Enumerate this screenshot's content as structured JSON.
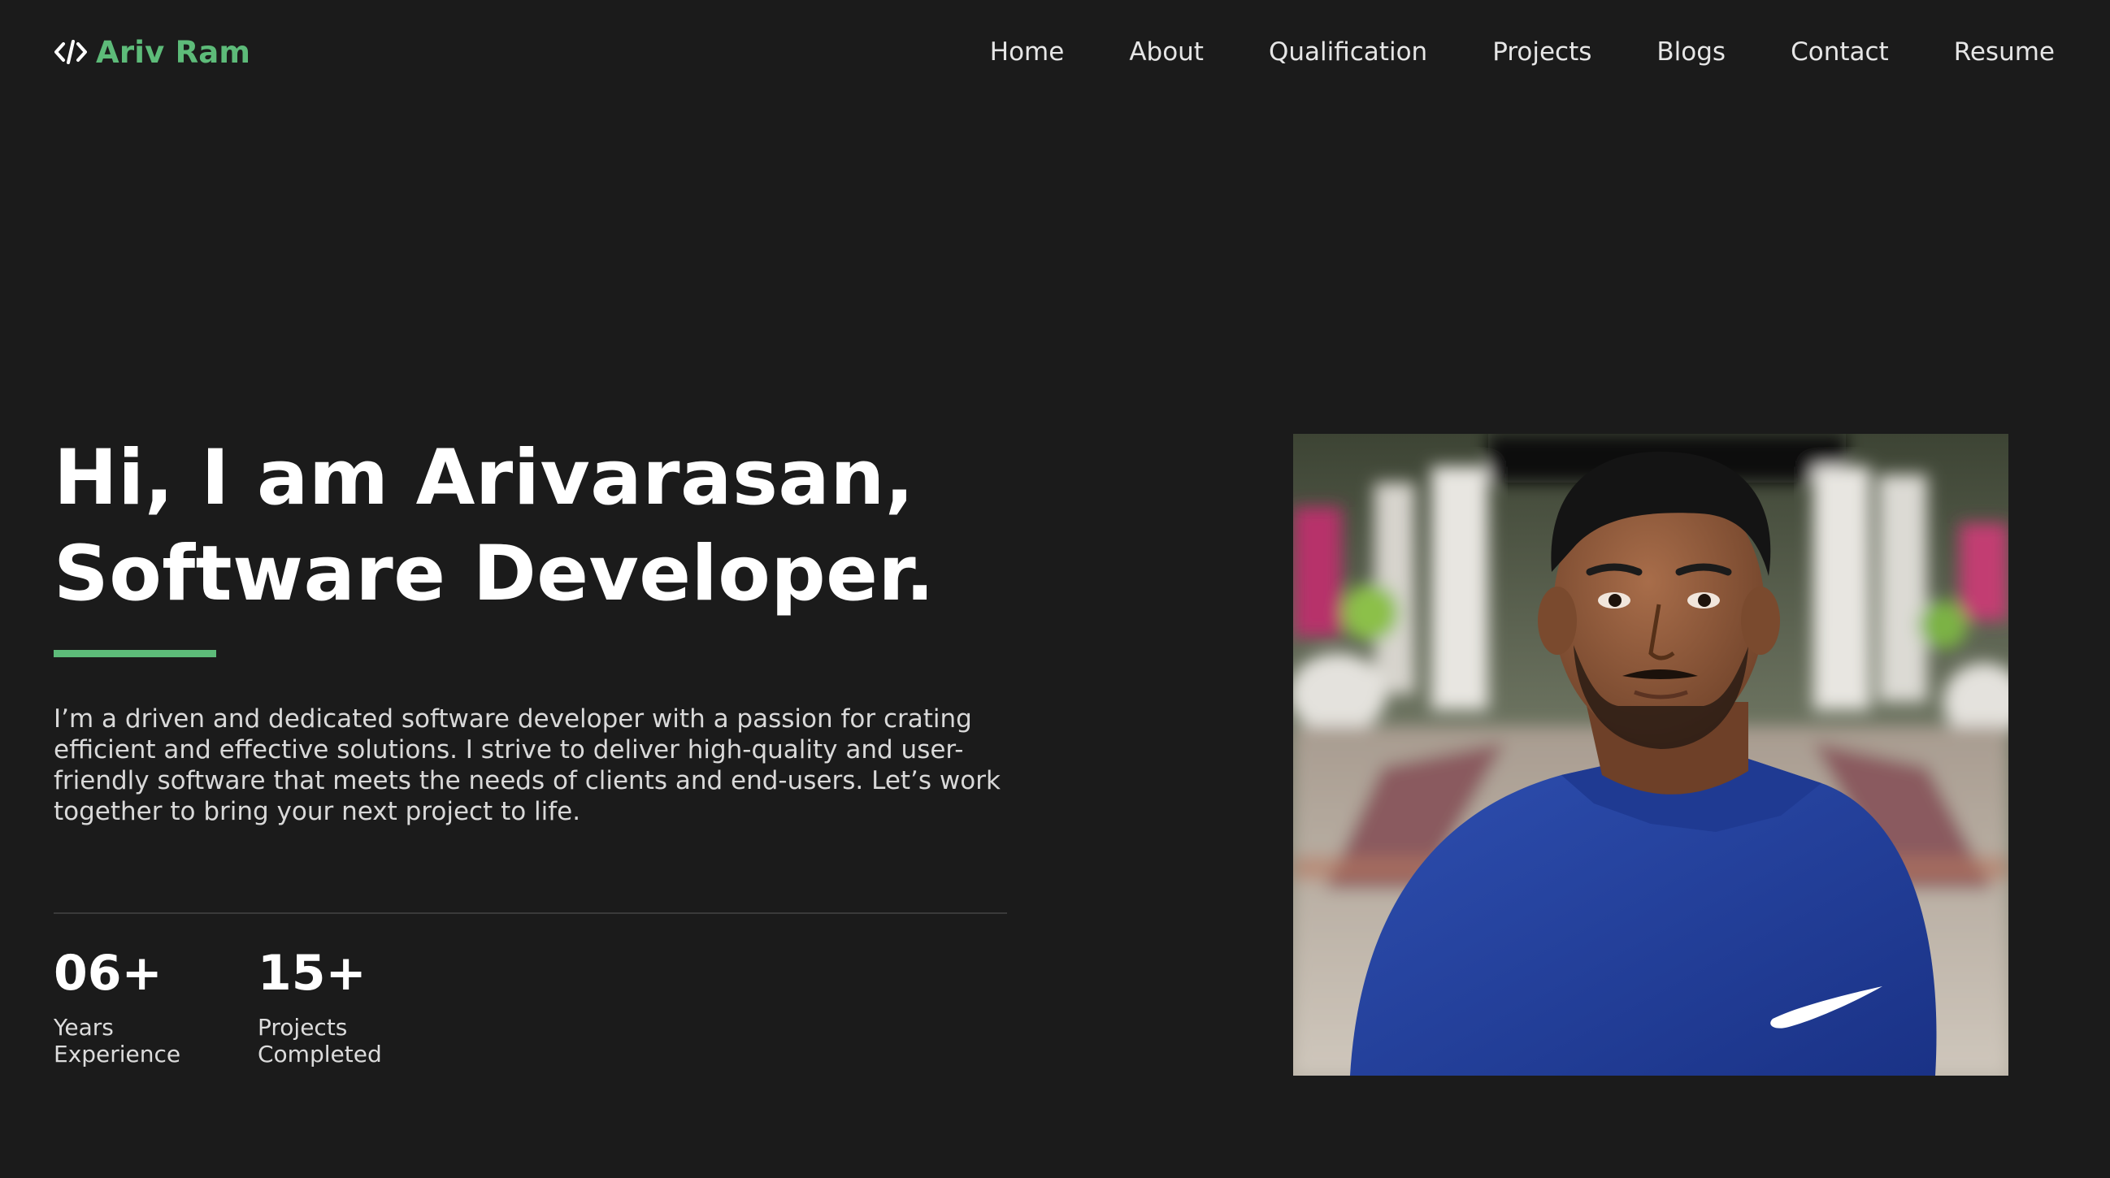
{
  "header": {
    "logo_text": "Ariv Ram",
    "logo_icon": "code-icon",
    "nav": [
      {
        "label": "Home"
      },
      {
        "label": "About"
      },
      {
        "label": "Qualification"
      },
      {
        "label": "Projects"
      },
      {
        "label": "Blogs"
      },
      {
        "label": "Contact"
      },
      {
        "label": "Resume"
      }
    ]
  },
  "hero": {
    "headline_line1": "Hi, I am Arivarasan,",
    "headline_line2": "Software Developer.",
    "intro": "I’m a driven and dedicated software developer with a passion for crating efficient and effective solutions. I strive to deliver high-quality and user-friendly software that meets the needs of clients and end-users. Let’s work together to bring your next project to life.",
    "stats": [
      {
        "value": "06+",
        "label_line1": "Years",
        "label_line2": "Experience"
      },
      {
        "value": "15+",
        "label_line1": "Projects",
        "label_line2": "Completed"
      }
    ]
  },
  "colors": {
    "background": "#1b1b1b",
    "accent": "#5dbb79",
    "text": "#ffffff",
    "muted_text": "#d9d9d9",
    "divider": "#3a3a3a"
  }
}
